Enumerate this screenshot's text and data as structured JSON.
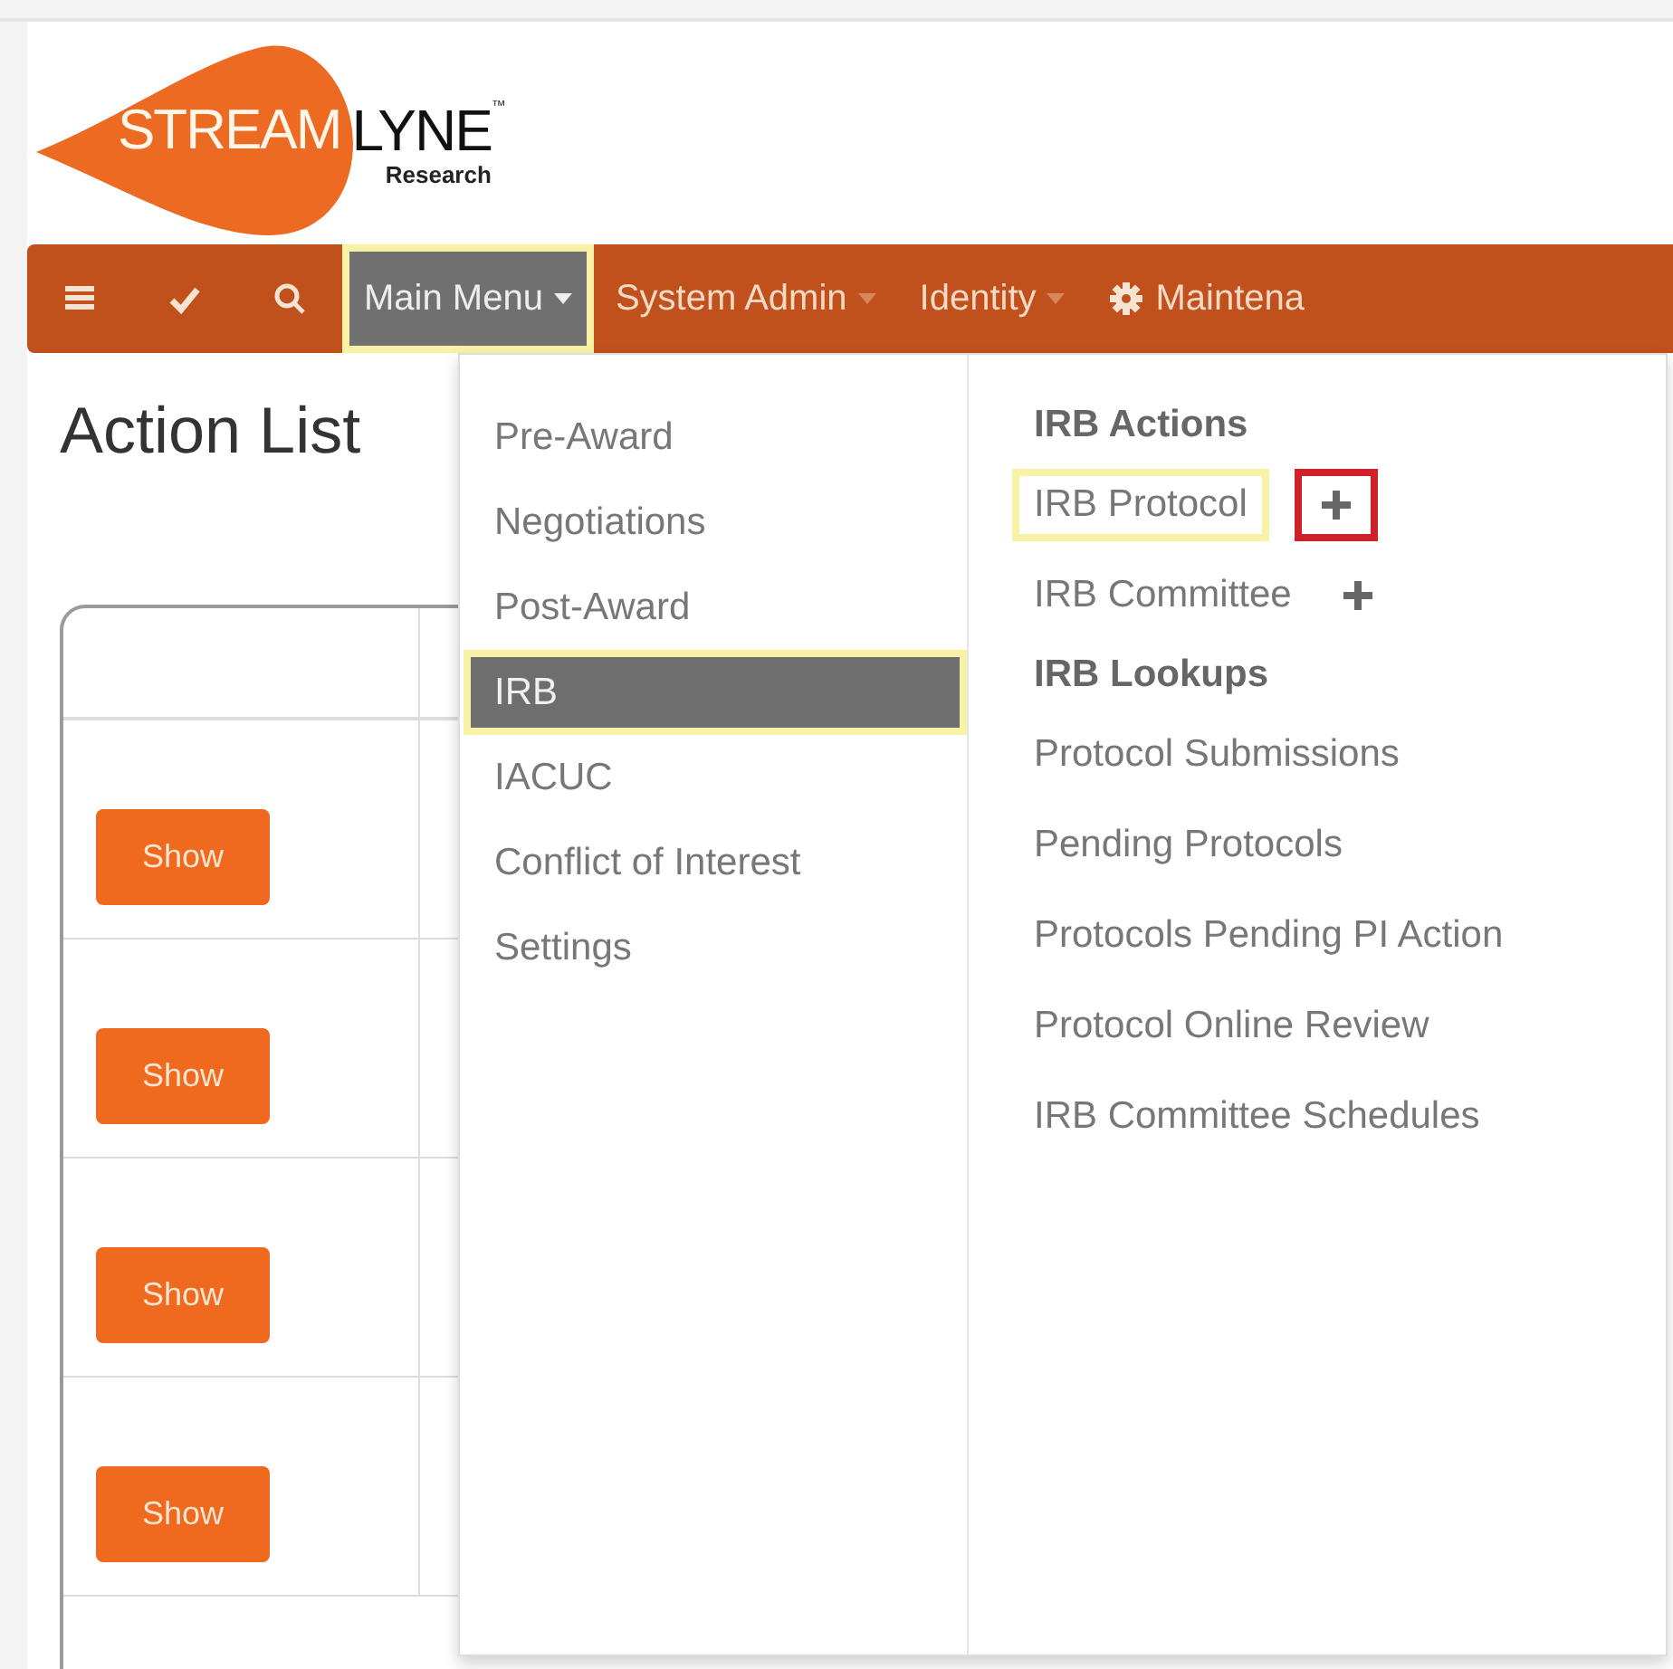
{
  "logo": {
    "word_1": "STREAM",
    "word_2": "LYNE",
    "trademark": "™",
    "subtitle": "Research"
  },
  "navbar": {
    "icon_buttons": [
      {
        "kind": "list"
      },
      {
        "kind": "check"
      },
      {
        "kind": "search"
      }
    ],
    "menus": [
      {
        "label": "Main Menu",
        "kind": "dropdown",
        "open": true,
        "highlighted": true
      },
      {
        "label": "System Admin",
        "kind": "dropdown",
        "open": false,
        "highlighted": false
      },
      {
        "label": "Identity",
        "kind": "dropdown",
        "open": false,
        "highlighted": false
      },
      {
        "label": "Maintena",
        "kind": "gear",
        "open": false,
        "highlighted": false
      }
    ]
  },
  "page_title": "Action List",
  "table": {
    "rows": [
      {
        "button": "Show"
      },
      {
        "button": "Show"
      },
      {
        "button": "Show"
      },
      {
        "button": "Show"
      }
    ]
  },
  "dropdown": {
    "categories": [
      {
        "label": "Pre-Award",
        "selected": false,
        "highlighted": false
      },
      {
        "label": "Negotiations",
        "selected": false,
        "highlighted": false
      },
      {
        "label": "Post-Award",
        "selected": false,
        "highlighted": false
      },
      {
        "label": "IRB",
        "selected": true,
        "highlighted": true
      },
      {
        "label": "IACUC",
        "selected": false,
        "highlighted": false
      },
      {
        "label": "Conflict of Interest",
        "selected": false,
        "highlighted": false
      },
      {
        "label": "Settings",
        "selected": false,
        "highlighted": false
      }
    ],
    "sections": [
      {
        "heading": "IRB Actions",
        "items": [
          {
            "label": "IRB Protocol",
            "add": true,
            "highlighted": true,
            "add_highlighted": true
          },
          {
            "label": "IRB Committee",
            "add": true,
            "highlighted": false,
            "add_highlighted": false
          }
        ]
      },
      {
        "heading": "IRB Lookups",
        "items": [
          {
            "label": "Protocol Submissions",
            "add": false,
            "highlighted": false
          },
          {
            "label": "Pending Protocols",
            "add": false,
            "highlighted": false
          },
          {
            "label": "Protocols Pending PI Action",
            "add": false,
            "highlighted": false
          },
          {
            "label": "Protocol Online Review",
            "add": false,
            "highlighted": false
          },
          {
            "label": "IRB Committee Schedules",
            "add": false,
            "highlighted": false
          }
        ]
      }
    ]
  }
}
